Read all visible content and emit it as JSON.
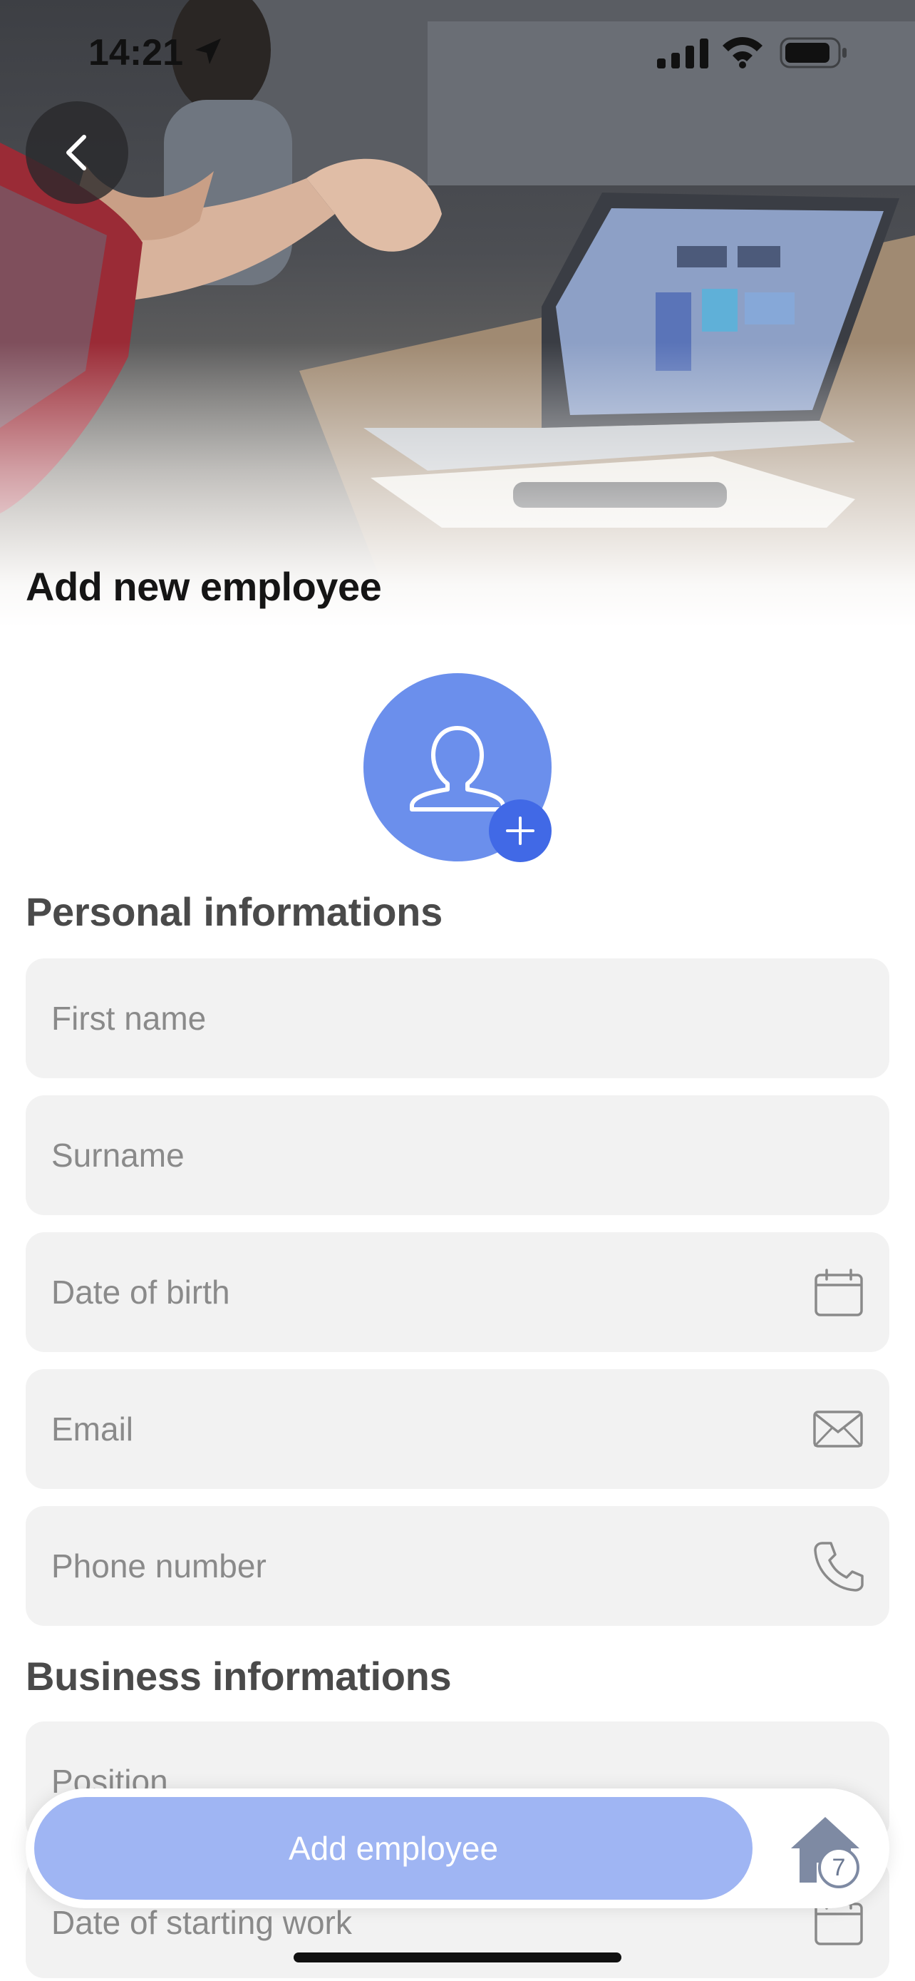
{
  "status_bar": {
    "time": "14:21"
  },
  "header": {
    "title": "Add new employee"
  },
  "sections": {
    "personal": {
      "title": "Personal informations",
      "fields": {
        "first_name": {
          "placeholder": "First name"
        },
        "surname": {
          "placeholder": "Surname"
        },
        "date_of_birth": {
          "placeholder": "Date of birth",
          "icon": "calendar-icon"
        },
        "email": {
          "placeholder": "Email",
          "icon": "envelope-icon"
        },
        "phone": {
          "placeholder": "Phone number",
          "icon": "phone-icon"
        }
      }
    },
    "business": {
      "title": "Business informations",
      "fields": {
        "position": {
          "placeholder": "Position"
        },
        "start_date": {
          "placeholder": "Date of starting work",
          "icon": "calendar-icon"
        }
      }
    }
  },
  "actions": {
    "add_employee": "Add employee"
  },
  "home": {
    "badge_count": "7"
  },
  "colors": {
    "accent": "#4169e6",
    "avatar": "#6b8fec",
    "button": "#9fb5f3",
    "field_bg": "#f2f2f2"
  }
}
